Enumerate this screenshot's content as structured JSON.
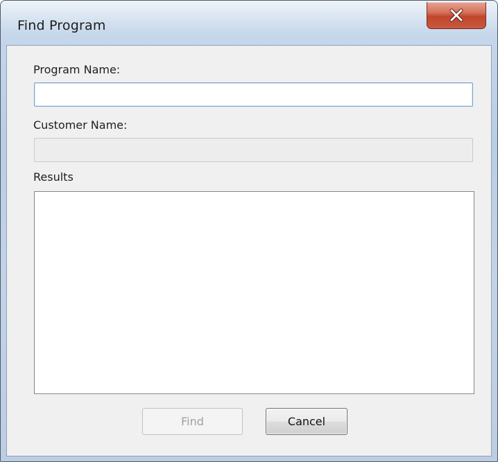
{
  "window": {
    "title": "Find Program"
  },
  "form": {
    "program_name_label": "Program Name:",
    "program_name_value": "",
    "customer_name_label": "Customer Name:",
    "customer_name_value": "",
    "results_label": "Results",
    "results_items": []
  },
  "buttons": {
    "find_label": "Find",
    "find_enabled": false,
    "cancel_label": "Cancel"
  },
  "icons": {
    "close": "close-icon"
  },
  "colors": {
    "close_button": "#c75a3e",
    "input_focus_border": "#7da2ce"
  }
}
